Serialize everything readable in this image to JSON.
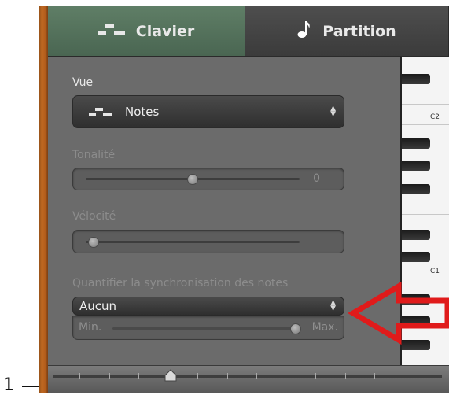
{
  "callout": {
    "number": "1"
  },
  "tabs": [
    {
      "label": "Clavier",
      "icon": "keyboard-notes-icon",
      "active": true
    },
    {
      "label": "Partition",
      "icon": "music-note-icon",
      "active": false
    }
  ],
  "vue": {
    "label": "Vue",
    "value": "Notes",
    "icon": "notes-icon"
  },
  "tonalite": {
    "label": "Tonalité",
    "value": "0"
  },
  "velocite": {
    "label": "Vélocité"
  },
  "quantize": {
    "label": "Quantifier la synchronisation des notes",
    "value": "Aucun",
    "min_label": "Min.",
    "max_label": "Max."
  },
  "keyboard": {
    "labels": [
      "C2",
      "C1"
    ]
  },
  "colors": {
    "active_tab": "#56735d",
    "panel": "#6b6b6b",
    "annotation_arrow": "#e01b1b",
    "wood": "#b35d1c"
  }
}
